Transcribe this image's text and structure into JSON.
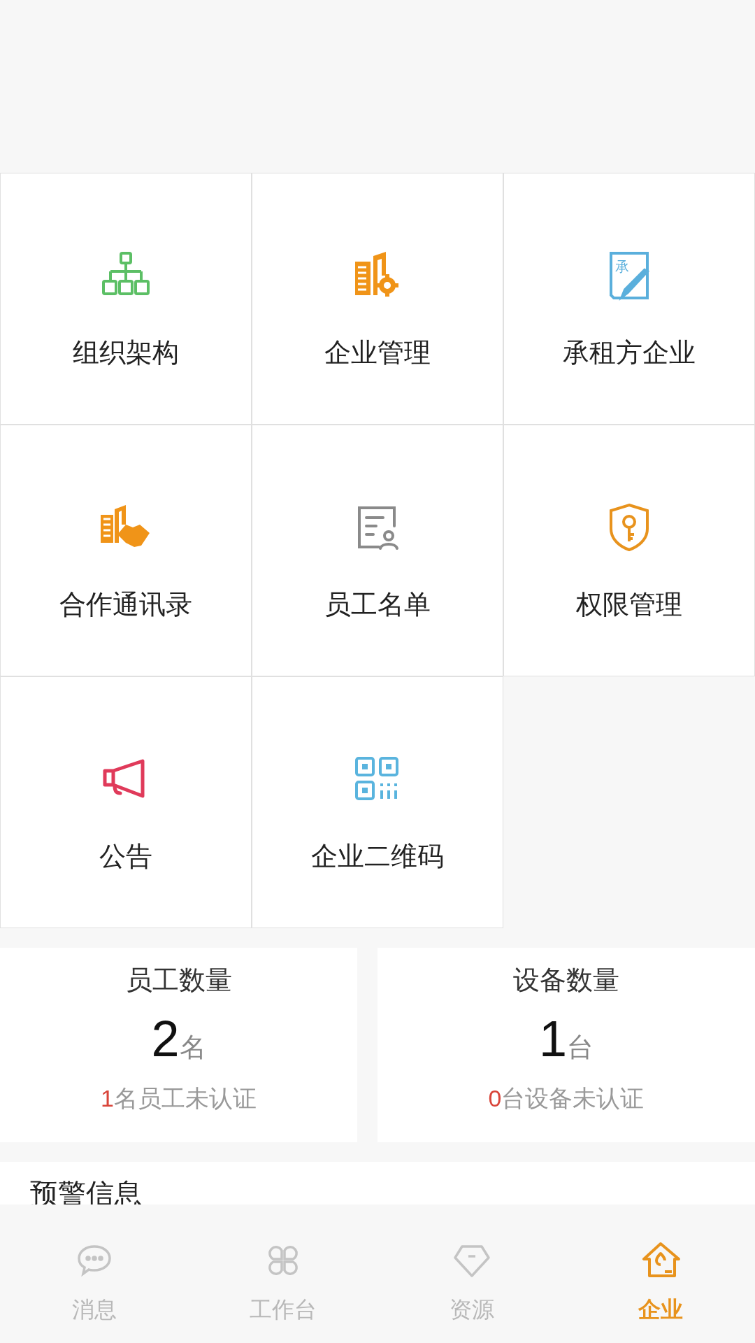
{
  "menu_grid": [
    {
      "label": "组织架构",
      "kind": "org-chart"
    },
    {
      "label": "企业管理",
      "kind": "building-gear"
    },
    {
      "label": "承租方企业",
      "kind": "lessee",
      "icon_text": "承"
    },
    {
      "label": "合作通讯录",
      "kind": "handshake"
    },
    {
      "label": "员工名单",
      "kind": "roster"
    },
    {
      "label": "权限管理",
      "kind": "shield-key"
    },
    {
      "label": "公告",
      "kind": "megaphone"
    },
    {
      "label": "企业二维码",
      "kind": "qr-code"
    }
  ],
  "stats": [
    {
      "title": "员工数量",
      "value": "2",
      "unit": "名",
      "pending_count": "1",
      "pending_text": "名员工未认证"
    },
    {
      "title": "设备数量",
      "value": "1",
      "unit": "台",
      "pending_count": "0",
      "pending_text": "台设备未认证"
    }
  ],
  "alerts": {
    "title": "预警信息"
  },
  "tab_bar": [
    {
      "label": "消息",
      "kind": "chat",
      "selected": false
    },
    {
      "label": "工作台",
      "kind": "apps",
      "selected": false
    },
    {
      "label": "资源",
      "kind": "diamond",
      "selected": false
    },
    {
      "label": "企业",
      "kind": "house",
      "selected": true
    }
  ]
}
